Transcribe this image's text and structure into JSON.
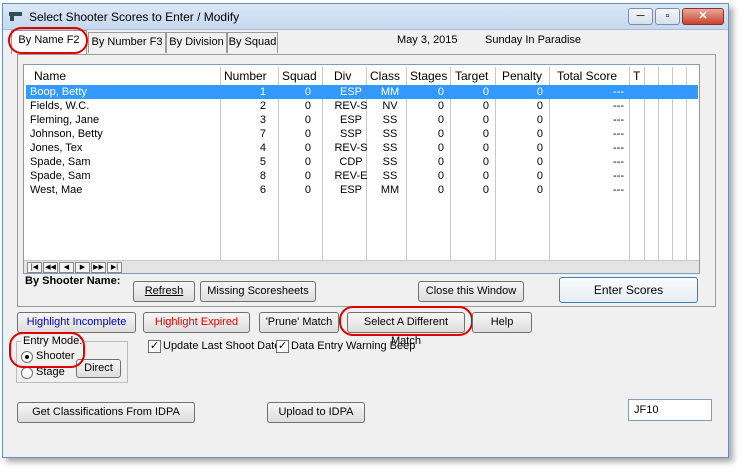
{
  "window": {
    "title": "Select Shooter Scores to Enter / Modify"
  },
  "tabs": [
    {
      "label": "By Name F2",
      "active": true
    },
    {
      "label": "By Number F3"
    },
    {
      "label": "By Division"
    },
    {
      "label": "By Squad"
    }
  ],
  "header": {
    "date": "May  3, 2015",
    "match": "Sunday In Paradise"
  },
  "grid": {
    "columns": [
      "Name",
      "Number",
      "Squad",
      "Div",
      "Class",
      "Stages",
      "Target",
      "Penalty",
      "Total Score",
      "T"
    ],
    "rows": [
      [
        "Boop, Betty",
        "1",
        "0",
        "ESP",
        "MM",
        "0",
        "0",
        "0",
        "---"
      ],
      [
        "Fields, W.C.",
        "2",
        "0",
        "REV-S",
        "NV",
        "0",
        "0",
        "0",
        "---"
      ],
      [
        "Fleming, Jane",
        "3",
        "0",
        "ESP",
        "SS",
        "0",
        "0",
        "0",
        "---"
      ],
      [
        "Johnson, Betty",
        "7",
        "0",
        "SSP",
        "SS",
        "0",
        "0",
        "0",
        "---"
      ],
      [
        "Jones, Tex",
        "4",
        "0",
        "REV-S",
        "SS",
        "0",
        "0",
        "0",
        "---"
      ],
      [
        "Spade, Sam",
        "5",
        "0",
        "CDP",
        "SS",
        "0",
        "0",
        "0",
        "---"
      ],
      [
        "Spade, Sam",
        "8",
        "0",
        "REV-E",
        "SS",
        "0",
        "0",
        "0",
        "---"
      ],
      [
        "West, Mae",
        "6",
        "0",
        "ESP",
        "MM",
        "0",
        "0",
        "0",
        "---"
      ]
    ],
    "selected_row": 0,
    "nav_buttons": [
      "|◀",
      "◀◀",
      "◀",
      "▶",
      "▶▶",
      "▶|"
    ]
  },
  "panel": {
    "by_label": "By Shooter Name:",
    "refresh": "Refresh",
    "missing": "Missing Scoresheets",
    "close": "Close this Window",
    "enter": "Enter Scores"
  },
  "actions": {
    "highlight_incomplete": "Highlight Incomplete",
    "highlight_expired": "Highlight Expired",
    "prune": "'Prune' Match",
    "select_match": "Select A Different  Match",
    "help": "Help"
  },
  "entry_mode": {
    "label": "Entry Mode:",
    "shooter": "Shooter",
    "stage": "Stage",
    "direct": "Direct",
    "selected": "shooter"
  },
  "options": {
    "update_last": "Update Last Shoot Date",
    "update_last_checked": true,
    "warning_beep": "Data Entry Warning Beep",
    "warning_beep_checked": true
  },
  "bottom": {
    "get_class": "Get Classifications From IDPA",
    "upload": "Upload to IDPA",
    "code": "JF10"
  },
  "colors": {
    "highlight_incomplete": "#0000cc",
    "highlight_expired": "#e00000",
    "selection": "#3399ff",
    "annotation": "#e00000"
  }
}
